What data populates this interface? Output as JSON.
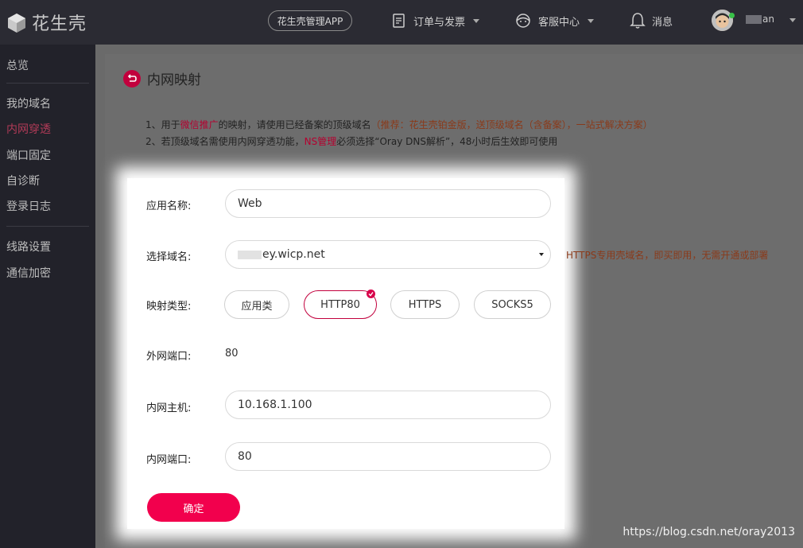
{
  "header": {
    "logo_text": "花生壳",
    "app_button": "花生壳管理APP",
    "nav": [
      {
        "label": "订单与发票",
        "icon": "invoice-icon"
      },
      {
        "label": "客服中心",
        "icon": "support-icon"
      },
      {
        "label": "消息",
        "icon": "bell-icon"
      }
    ],
    "username": "an"
  },
  "sidebar": {
    "items": [
      {
        "label": "总览"
      },
      {
        "label": "我的域名"
      },
      {
        "label": "内网穿透"
      },
      {
        "label": "端口固定"
      },
      {
        "label": "自诊断"
      },
      {
        "label": "登录日志"
      },
      {
        "label": "线路设置"
      },
      {
        "label": "通信加密"
      }
    ],
    "active": "内网穿透"
  },
  "page": {
    "title": "内网映射",
    "notes": {
      "line1_a": "1、用于",
      "line1_b": "微信推广",
      "line1_c": "的映射，请使用已经备案的顶级域名",
      "line1_d": "（推荐：花生壳铂金版，送顶级域名（含备案），一站式解决方案）",
      "line2_a": "2、若顶级域名需使用内网穿透功能，",
      "line2_b": "NS管理",
      "line2_c": "必须选择“Oray DNS解析”，48小时后生效即可使用"
    }
  },
  "form": {
    "app_name_label": "应用名称:",
    "app_name_value": "Web",
    "domain_label": "选择域名:",
    "domain_value": "ey.wicp.net",
    "https_note": "HTTPS专用壳域名，即买即用，无需开通或部署",
    "type_label": "映射类型:",
    "types": [
      "应用类",
      "HTTP80",
      "HTTPS",
      "SOCKS5"
    ],
    "selected_type": "HTTP80",
    "ext_port_label": "外网端口:",
    "ext_port_value": "80",
    "host_label": "内网主机:",
    "host_value": "10.168.1.100",
    "int_port_label": "内网端口:",
    "int_port_value": "80",
    "submit": "确定"
  },
  "watermark": "https://blog.csdn.net/oray2013",
  "colors": {
    "accent": "#f2004d",
    "header_bg": "#2b2b33",
    "sidebar_bg": "#22222a"
  }
}
